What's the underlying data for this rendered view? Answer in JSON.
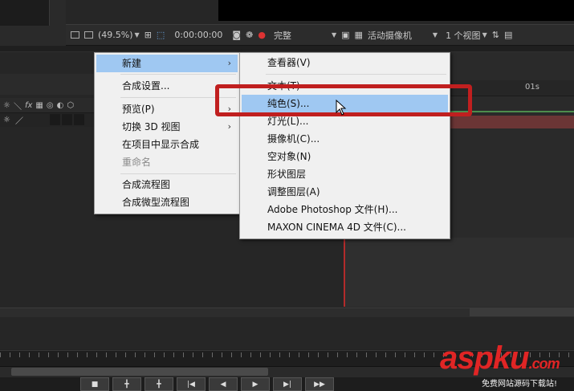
{
  "viewer_toolbar": {
    "zoom": "(49.5%)",
    "timecode": "0:00:00:00",
    "resolution": "完整",
    "camera": "活动摄像机",
    "view": "1 个视图"
  },
  "timeline": {
    "ruler_label": "01s"
  },
  "context_menu": {
    "items": [
      {
        "label": "新建",
        "has_submenu": true,
        "highlighted": true
      },
      {
        "label": "合成设置..."
      },
      {
        "label": "预览(P)",
        "has_submenu": true
      },
      {
        "label": "切换 3D 视图",
        "has_submenu": true
      },
      {
        "label": "在项目中显示合成"
      },
      {
        "label": "重命名",
        "disabled": true
      },
      {
        "label": "合成流程图"
      },
      {
        "label": "合成微型流程图"
      }
    ]
  },
  "submenu_new": {
    "items": [
      {
        "label": "查看器(V)"
      },
      {
        "label": "文本(T)"
      },
      {
        "label": "纯色(S)...",
        "highlighted": true
      },
      {
        "label": "灯光(L)..."
      },
      {
        "label": "摄像机(C)..."
      },
      {
        "label": "空对象(N)"
      },
      {
        "label": "形状图层"
      },
      {
        "label": "调整图层(A)"
      },
      {
        "label": "Adobe Photoshop 文件(H)..."
      },
      {
        "label": "MAXON CINEMA 4D 文件(C)..."
      }
    ]
  },
  "icons": {
    "submenu_arrow": "›",
    "fx": "fx"
  },
  "watermark": {
    "brand": "aspku",
    "domain": ".com",
    "subtitle": "免费网站源码下载站!"
  },
  "colors": {
    "highlight": "#9fc8f2",
    "annotation_red": "#c01f1f",
    "watermark_red": "#e02525"
  }
}
